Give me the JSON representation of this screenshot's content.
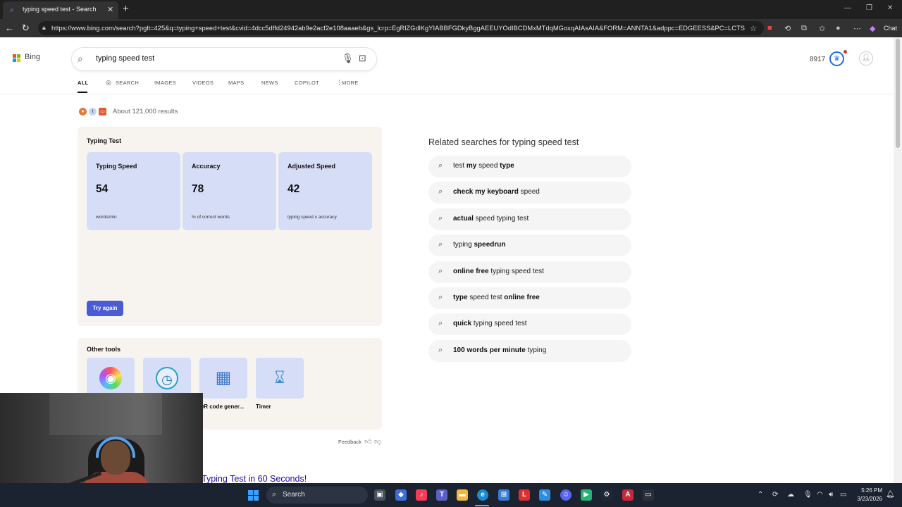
{
  "browser": {
    "tab_title": "typing speed test - Search",
    "tab_close": "✕",
    "new_tab": "+",
    "url": "https://www.bing.com/search?pglt=425&q=typing+speed+test&cvid=4dcc5dffd24942ab9e2acf2e108aaaeb&gs_lcrp=EgRlZGdlKgYIABBFGDkyBggAEEUYOdIBCDMxMTdqMGoxqAIAsAIA&FORM=ANNTA1&adppc=EDGEESS&PC=LCTS",
    "chat_label": "Chat"
  },
  "header": {
    "logo_text": "Bing",
    "search_value": "typing speed test",
    "rewards_count": "8917"
  },
  "scopes": {
    "all": "ALL",
    "search": "SEARCH",
    "images": "IMAGES",
    "videos": "VIDEOS",
    "maps": "MAPS",
    "news": "NEWS",
    "copilot": "COPILOT",
    "more": "MORE"
  },
  "results_count": "About 121,000 results",
  "typing_test": {
    "title": "Typing Test",
    "stats": [
      {
        "label": "Typing Speed",
        "value": "54",
        "unit": "words/min"
      },
      {
        "label": "Accuracy",
        "value": "78",
        "unit": "% of correct words"
      },
      {
        "label": "Adjusted Speed",
        "value": "42",
        "unit": "typing speed x accuracy"
      }
    ],
    "try_again": "Try again"
  },
  "other_tools": {
    "title": "Other tools",
    "items": [
      {
        "label": "",
        "icon": "color-wheel-icon"
      },
      {
        "label": "",
        "icon": "stopwatch-icon"
      },
      {
        "label": "QR code gener...",
        "icon": "qr-code-icon"
      },
      {
        "label": "Timer",
        "icon": "hourglass-icon"
      }
    ]
  },
  "feedback": "Feedback",
  "next_result_title": "Typing Test in 60 Seconds!",
  "related": {
    "heading": "Related searches for typing speed test",
    "items": [
      {
        "parts": [
          {
            "t": "test ",
            "b": false
          },
          {
            "t": "my",
            "b": true
          },
          {
            "t": " speed ",
            "b": false
          },
          {
            "t": "type",
            "b": true
          }
        ]
      },
      {
        "parts": [
          {
            "t": "check my keyboard",
            "b": true
          },
          {
            "t": " speed",
            "b": false
          }
        ]
      },
      {
        "parts": [
          {
            "t": "actual",
            "b": true
          },
          {
            "t": " speed typing test",
            "b": false
          }
        ]
      },
      {
        "parts": [
          {
            "t": "typing ",
            "b": false
          },
          {
            "t": "speedrun",
            "b": true
          }
        ]
      },
      {
        "parts": [
          {
            "t": "online free",
            "b": true
          },
          {
            "t": " typing speed test",
            "b": false
          }
        ]
      },
      {
        "parts": [
          {
            "t": "type",
            "b": true
          },
          {
            "t": " speed test ",
            "b": false
          },
          {
            "t": "online free",
            "b": true
          }
        ]
      },
      {
        "parts": [
          {
            "t": "quick",
            "b": true
          },
          {
            "t": " typing speed test",
            "b": false
          }
        ]
      },
      {
        "parts": [
          {
            "t": "100 words per minute",
            "b": true
          },
          {
            "t": " typing",
            "b": false
          }
        ]
      }
    ]
  },
  "taskbar": {
    "search_label": "Search",
    "time": "5:26 PM",
    "date": "3/23/2026"
  },
  "colors": {
    "accent": "#4a5bd6",
    "stat_bg": "#d6ddf7",
    "card_bg": "#f7f4f0",
    "link": "#1a0dab"
  }
}
